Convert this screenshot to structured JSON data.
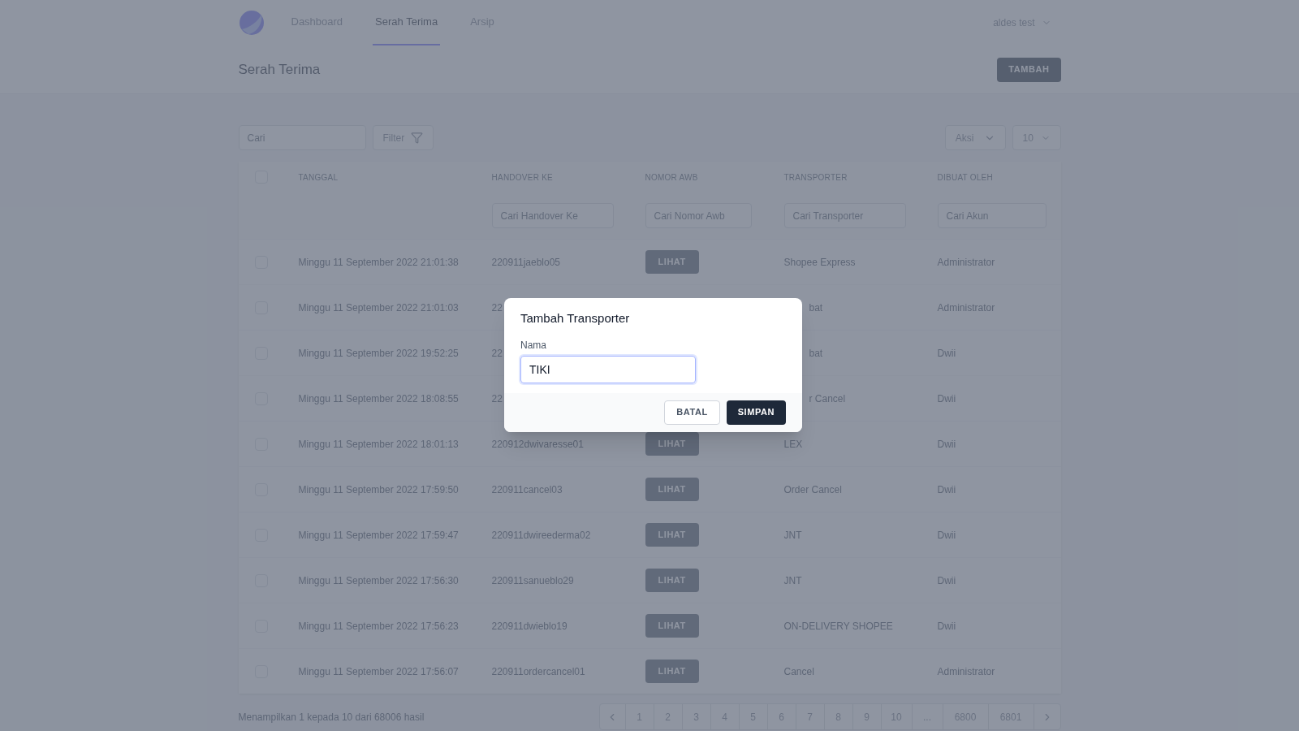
{
  "nav": {
    "items": [
      {
        "label": "Dashboard",
        "selected": false
      },
      {
        "label": "Serah Terima",
        "selected": true
      },
      {
        "label": "Arsip",
        "selected": false
      }
    ],
    "user": "aldes test"
  },
  "page": {
    "title": "Serah Terima",
    "add_button": "TAMBAH"
  },
  "toolbar": {
    "search": {
      "placeholder": "Cari"
    },
    "filter": "Filter",
    "action": "Aksi",
    "page_size": "10"
  },
  "table": {
    "header_checked": false,
    "columns": [
      "TANGGAL",
      "HANDOVER KE",
      "NOMOR AWB",
      "TRANSPORTER",
      "DIBUAT OLEH"
    ],
    "filters": [
      {
        "placeholder": "Cari Handover Ke"
      },
      {
        "placeholder": "Cari Nomor Awb"
      },
      {
        "placeholder": "Cari Transporter"
      },
      {
        "placeholder": "Cari Akun"
      }
    ],
    "rows": [
      {
        "kind": "full",
        "checked": false,
        "date": "Minggu 11 September 2022 21:01:38",
        "handover": "220911jaeblo05",
        "awb": "LIHAT",
        "transporter": "Shopee Express",
        "creator": "Administrator"
      },
      {
        "kind": "covered",
        "checked": false,
        "date": "Minggu 11 September 2022 21:01:03",
        "handover": "22",
        "transporter": "bat",
        "creator": "Administrator"
      },
      {
        "kind": "covered",
        "checked": false,
        "date": "Minggu 11 September 2022 19:52:25",
        "handover": "22",
        "transporter": "bat",
        "creator": "Dwii"
      },
      {
        "kind": "covered",
        "checked": false,
        "date": "Minggu 11 September 2022 18:08:55",
        "handover": "22",
        "transporter": "r Cancel",
        "creator": "Dwii"
      },
      {
        "kind": "full",
        "checked": false,
        "date": "Minggu 11 September 2022 18:01:13",
        "handover": "220912dwivaresse01",
        "awb": "LIHAT",
        "transporter": "LEX",
        "creator": "Dwii"
      },
      {
        "kind": "full",
        "checked": false,
        "date": "Minggu 11 September 2022 17:59:50",
        "handover": "220911cancel03",
        "awb": "LIHAT",
        "transporter": "Order Cancel",
        "creator": "Dwii"
      },
      {
        "kind": "full",
        "checked": false,
        "date": "Minggu 11 September 2022 17:59:47",
        "handover": "220911dwireederma02",
        "awb": "LIHAT",
        "transporter": "JNT",
        "creator": "Dwii"
      },
      {
        "kind": "full",
        "checked": false,
        "date": "Minggu 11 September 2022 17:56:30",
        "handover": "220911sanueblo29",
        "awb": "LIHAT",
        "transporter": "JNT",
        "creator": "Dwii"
      },
      {
        "kind": "full",
        "checked": false,
        "date": "Minggu 11 September 2022 17:56:23",
        "handover": "220911dwieblo19",
        "awb": "LIHAT",
        "transporter": "ON-DELIVERY SHOPEE",
        "creator": "Dwii"
      },
      {
        "kind": "full",
        "checked": false,
        "date": "Minggu 11 September 2022 17:56:07",
        "handover": "220911ordercancel01",
        "awb": "LIHAT",
        "transporter": "Cancel",
        "creator": "Administrator"
      }
    ]
  },
  "footer": {
    "summary": "Menampilkan 1 kepada 10 dari 68006 hasil",
    "pages": [
      "1",
      "2",
      "3",
      "4",
      "5",
      "6",
      "7",
      "8",
      "9",
      "10",
      "...",
      "6800",
      "6801"
    ]
  },
  "dialog": {
    "title": "Tambah Transporter",
    "label": "Nama",
    "value": "TIKI",
    "cancel": "BATAL",
    "save": "SIMPAN"
  }
}
